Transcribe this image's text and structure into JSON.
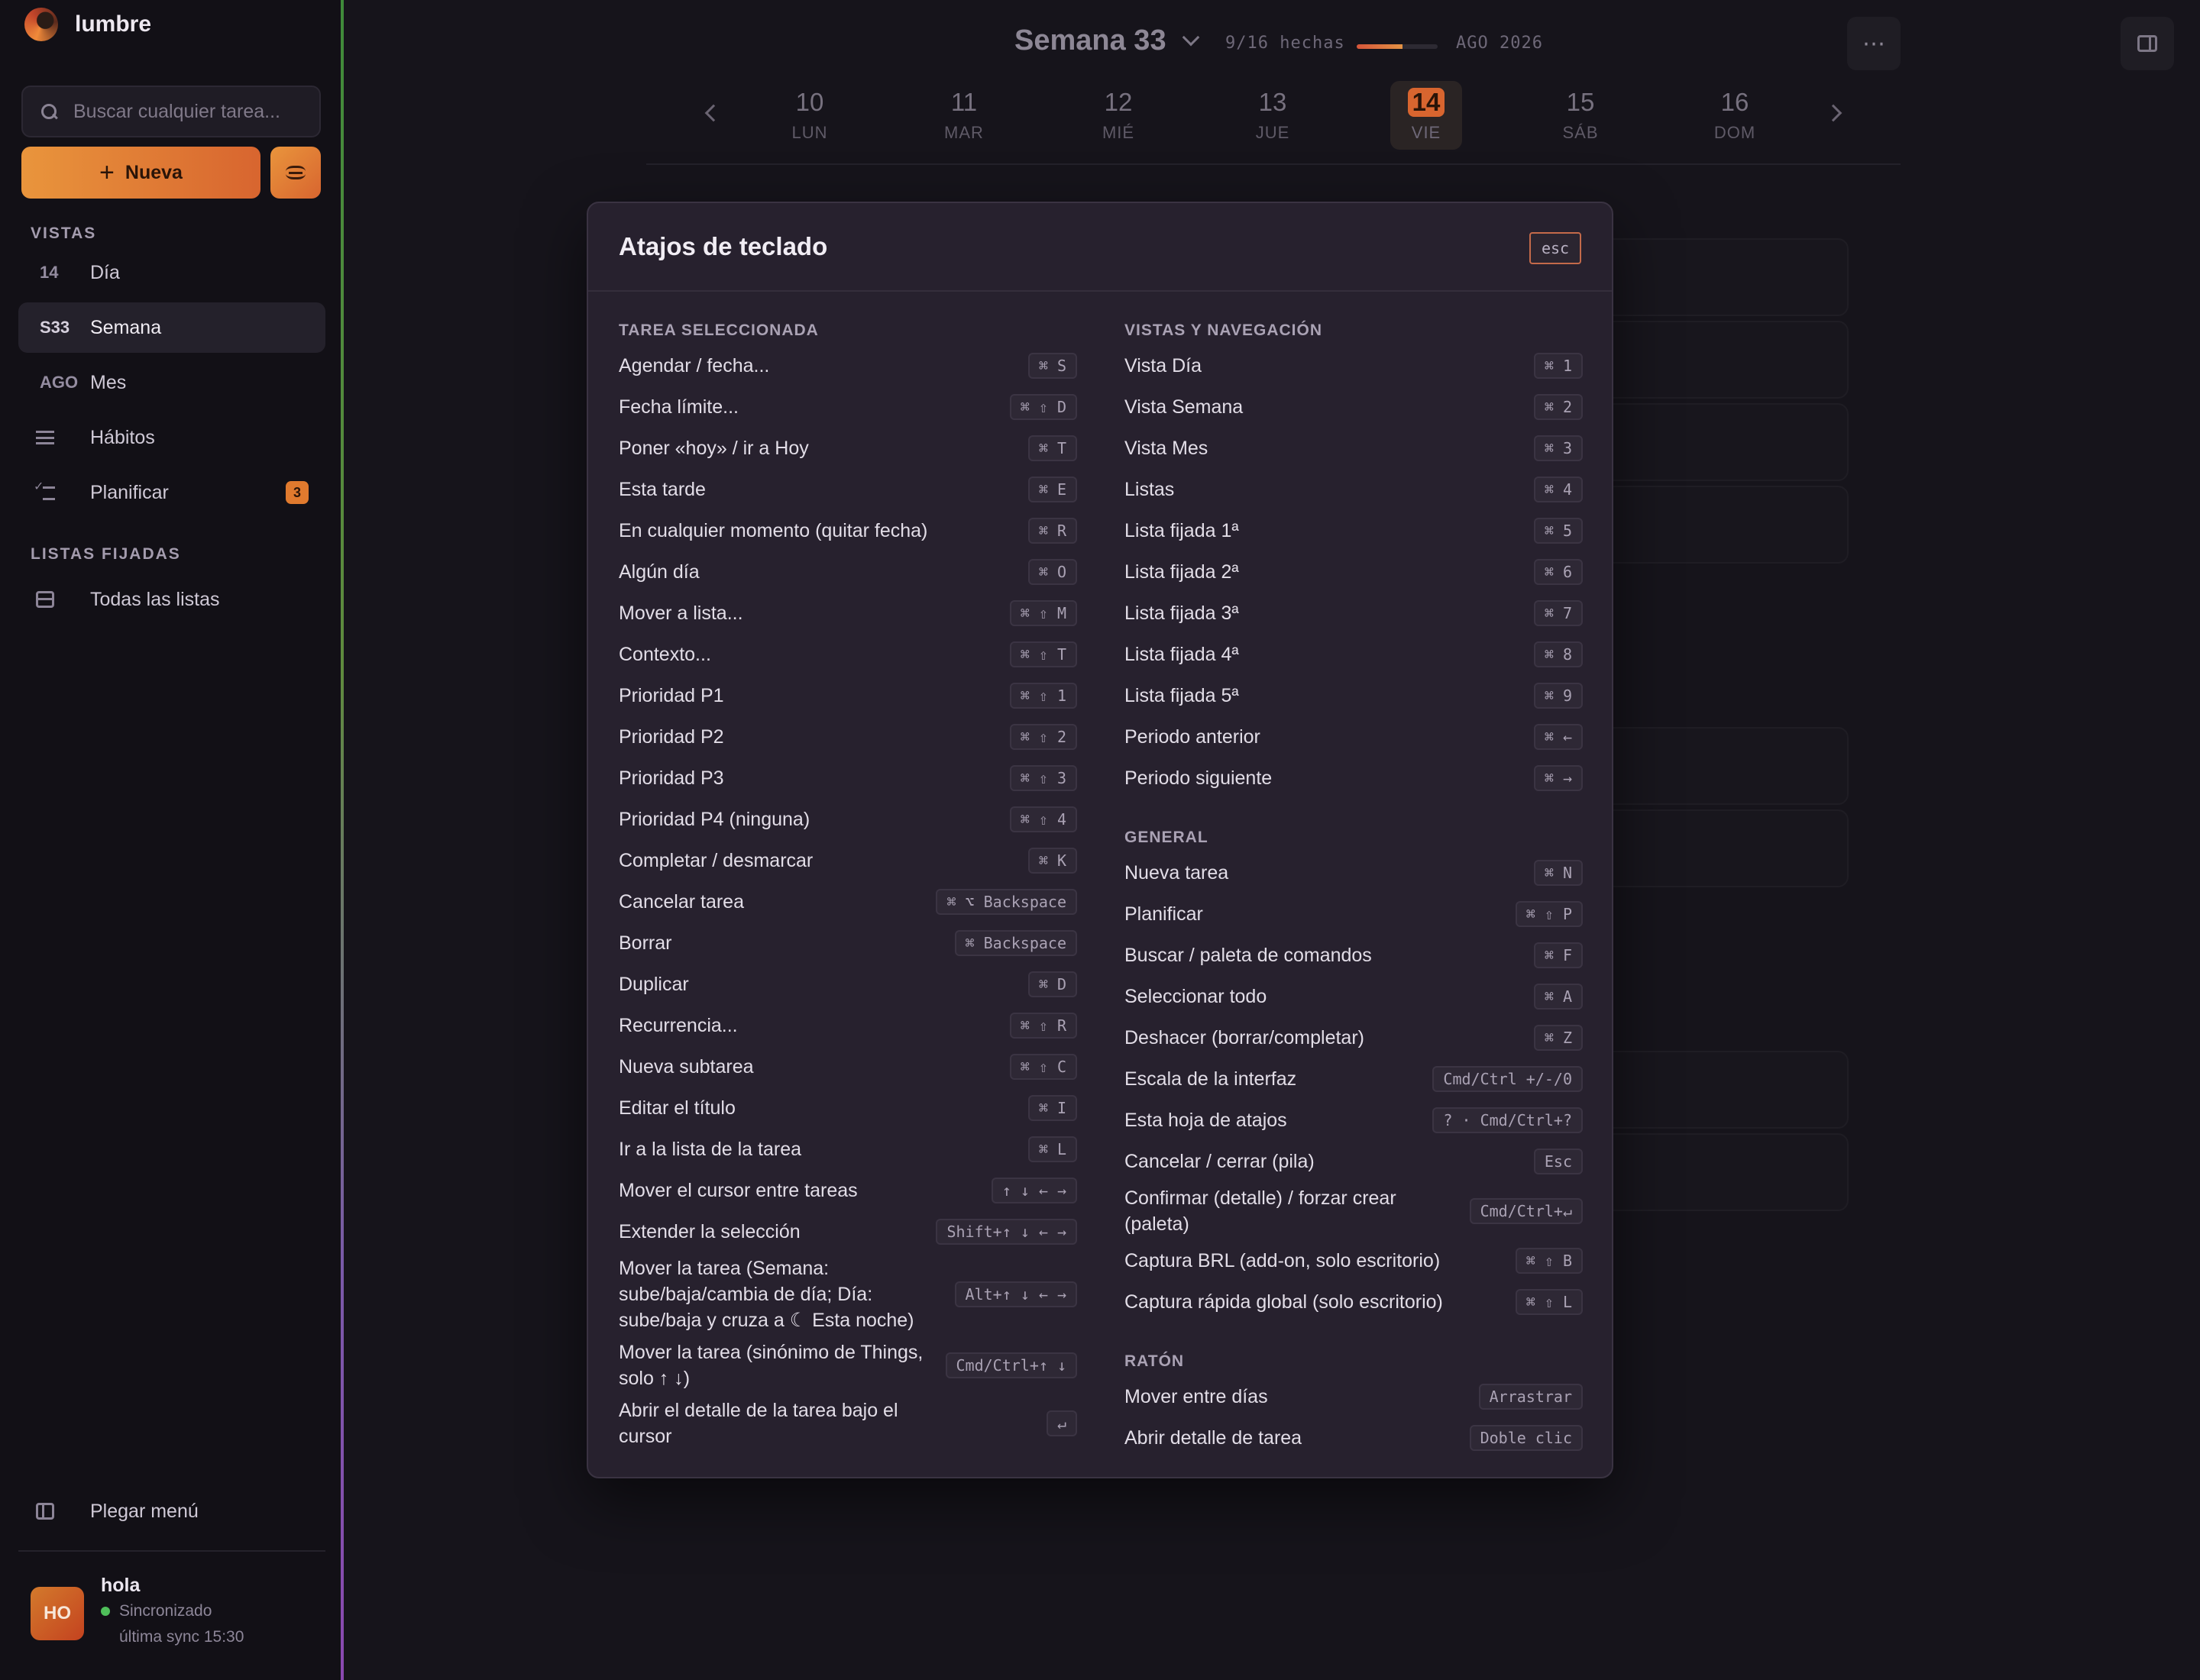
{
  "app": {
    "name": "lumbre"
  },
  "sidebar": {
    "search_placeholder": "Buscar cualquier tarea...",
    "new_label": "Nueva",
    "views_title": "VISTAS",
    "views": [
      {
        "code": "14",
        "label": "Día"
      },
      {
        "code": "S33",
        "label": "Semana"
      },
      {
        "code": "AGO",
        "label": "Mes"
      },
      {
        "label": "Hábitos"
      },
      {
        "label": "Planificar",
        "badge": "3"
      }
    ],
    "pinned_title": "LISTAS FIJADAS",
    "pinned": [
      {
        "label": "Todas las listas"
      }
    ],
    "collapse_label": "Plegar menú",
    "user": {
      "initials": "HO",
      "name": "hola",
      "status": "Sincronizado",
      "last_sync": "última sync 15:30"
    }
  },
  "header": {
    "week_title": "Semana 33",
    "done_count": "9/16 hechas",
    "progress": 0.5625,
    "month": "AGO 2026"
  },
  "week_days": [
    {
      "num": "10",
      "name": "LUN"
    },
    {
      "num": "11",
      "name": "MAR"
    },
    {
      "num": "12",
      "name": "MIÉ"
    },
    {
      "num": "13",
      "name": "JUE"
    },
    {
      "num": "14",
      "name": "VIE",
      "today": true
    },
    {
      "num": "15",
      "name": "SÁB"
    },
    {
      "num": "16",
      "name": "DOM"
    }
  ],
  "modal": {
    "title": "Atajos de teclado",
    "close_key": "esc",
    "left_groups": [
      {
        "title": "TAREA SELECCIONADA",
        "items": [
          {
            "label": "Agendar / fecha...",
            "key": "⌘ S"
          },
          {
            "label": "Fecha límite...",
            "key": "⌘ ⇧ D"
          },
          {
            "label": "Poner «hoy» / ir a Hoy",
            "key": "⌘ T"
          },
          {
            "label": "Esta tarde",
            "key": "⌘ E"
          },
          {
            "label": "En cualquier momento (quitar fecha)",
            "key": "⌘ R"
          },
          {
            "label": "Algún día",
            "key": "⌘ O"
          },
          {
            "label": "Mover a lista...",
            "key": "⌘ ⇧ M"
          },
          {
            "label": "Contexto...",
            "key": "⌘ ⇧ T"
          },
          {
            "label": "Prioridad P1",
            "key": "⌘ ⇧ 1"
          },
          {
            "label": "Prioridad P2",
            "key": "⌘ ⇧ 2"
          },
          {
            "label": "Prioridad P3",
            "key": "⌘ ⇧ 3"
          },
          {
            "label": "Prioridad P4 (ninguna)",
            "key": "⌘ ⇧ 4"
          },
          {
            "label": "Completar / desmarcar",
            "key": "⌘ K"
          },
          {
            "label": "Cancelar tarea",
            "key": "⌘ ⌥ Backspace"
          },
          {
            "label": "Borrar",
            "key": "⌘ Backspace"
          },
          {
            "label": "Duplicar",
            "key": "⌘ D"
          },
          {
            "label": "Recurrencia...",
            "key": "⌘ ⇧ R"
          },
          {
            "label": "Nueva subtarea",
            "key": "⌘ ⇧ C"
          },
          {
            "label": "Editar el título",
            "key": "⌘ I"
          },
          {
            "label": "Ir a la lista de la tarea",
            "key": "⌘ L"
          },
          {
            "label": "Mover el cursor entre tareas",
            "key": "↑ ↓ ← →"
          },
          {
            "label": "Extender la selección",
            "key": "Shift+↑ ↓ ← →"
          },
          {
            "label": "Mover la tarea (Semana: sube/baja/cambia de día; Día: sube/baja y cruza a ☾ Esta noche)",
            "key": "Alt+↑ ↓ ← →"
          },
          {
            "label": "Mover la tarea (sinónimo de Things, solo ↑ ↓)",
            "key": "Cmd/Ctrl+↑ ↓"
          },
          {
            "label": "Abrir el detalle de la tarea bajo el cursor",
            "key": "↵"
          }
        ]
      }
    ],
    "right_groups": [
      {
        "title": "VISTAS Y NAVEGACIÓN",
        "items": [
          {
            "label": "Vista Día",
            "key": "⌘ 1"
          },
          {
            "label": "Vista Semana",
            "key": "⌘ 2"
          },
          {
            "label": "Vista Mes",
            "key": "⌘ 3"
          },
          {
            "label": "Listas",
            "key": "⌘ 4"
          },
          {
            "label": "Lista fijada 1ª",
            "key": "⌘ 5"
          },
          {
            "label": "Lista fijada 2ª",
            "key": "⌘ 6"
          },
          {
            "label": "Lista fijada 3ª",
            "key": "⌘ 7"
          },
          {
            "label": "Lista fijada 4ª",
            "key": "⌘ 8"
          },
          {
            "label": "Lista fijada 5ª",
            "key": "⌘ 9"
          },
          {
            "label": "Periodo anterior",
            "key": "⌘ ←"
          },
          {
            "label": "Periodo siguiente",
            "key": "⌘ →"
          }
        ]
      },
      {
        "title": "GENERAL",
        "items": [
          {
            "label": "Nueva tarea",
            "key": "⌘ N"
          },
          {
            "label": "Planificar",
            "key": "⌘ ⇧ P"
          },
          {
            "label": "Buscar / paleta de comandos",
            "key": "⌘ F"
          },
          {
            "label": "Seleccionar todo",
            "key": "⌘ A"
          },
          {
            "label": "Deshacer (borrar/completar)",
            "key": "⌘ Z"
          },
          {
            "label": "Escala de la interfaz",
            "key": "Cmd/Ctrl +/-/0"
          },
          {
            "label": "Esta hoja de atajos",
            "key": "? · Cmd/Ctrl+?"
          },
          {
            "label": "Cancelar / cerrar (pila)",
            "key": "Esc"
          },
          {
            "label": "Confirmar (detalle) / forzar crear (paleta)",
            "key": "Cmd/Ctrl+↵"
          },
          {
            "label": "Captura BRL (add-on, solo escritorio)",
            "key": "⌘ ⇧ B"
          },
          {
            "label": "Captura rápida global (solo escritorio)",
            "key": "⌘ ⇧ L"
          }
        ]
      },
      {
        "title": "RATÓN",
        "items": [
          {
            "label": "Mover entre días",
            "key": "Arrastrar"
          },
          {
            "label": "Abrir detalle de tarea",
            "key": "Doble clic"
          }
        ]
      }
    ]
  },
  "colors": {
    "accent": "#e07a2e",
    "sync_ok": "#4fbf5a",
    "modal_bg": "#27212e"
  }
}
